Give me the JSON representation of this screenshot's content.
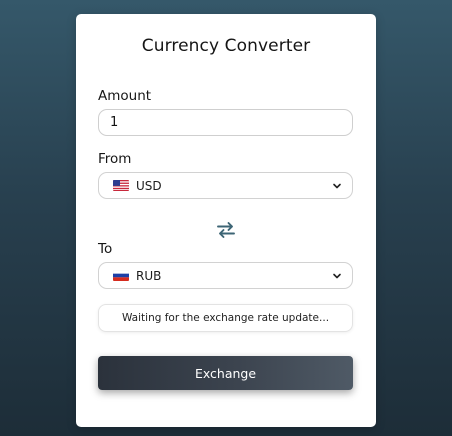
{
  "app": {
    "title": "Currency Converter"
  },
  "amount": {
    "label": "Amount",
    "value": "1"
  },
  "from": {
    "label": "From",
    "currency": "USD",
    "flag_icon": "us-flag-icon"
  },
  "swap": {
    "icon": "swap-arrows-icon",
    "color": "#3d6575"
  },
  "to": {
    "label": "To",
    "currency": "RUB",
    "flag_icon": "russia-flag-icon"
  },
  "status": {
    "text": "Waiting for the exchange rate update..."
  },
  "exchange_button": {
    "label": "Exchange"
  },
  "colors": {
    "background_top": "#35586a",
    "background_bottom": "#1d2d38",
    "button_dark": "#2b323c",
    "button_light": "#4f5a66"
  }
}
